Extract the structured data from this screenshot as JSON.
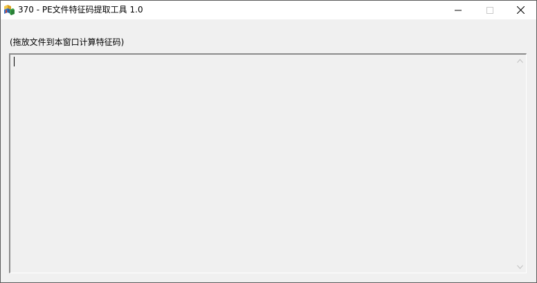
{
  "window": {
    "title": "370 - PE文件特征码提取工具 1.0",
    "icon": "app-blocks-icon",
    "controls": [
      "minimize-icon",
      "maximize-icon",
      "close-icon"
    ]
  },
  "main": {
    "hint": "(拖放文件到本窗口计算特征码)",
    "output_text": ""
  },
  "colors": {
    "window_bg": "#f0f0f0",
    "titlebar_bg": "#ffffff",
    "border": "#5a5a5a"
  }
}
